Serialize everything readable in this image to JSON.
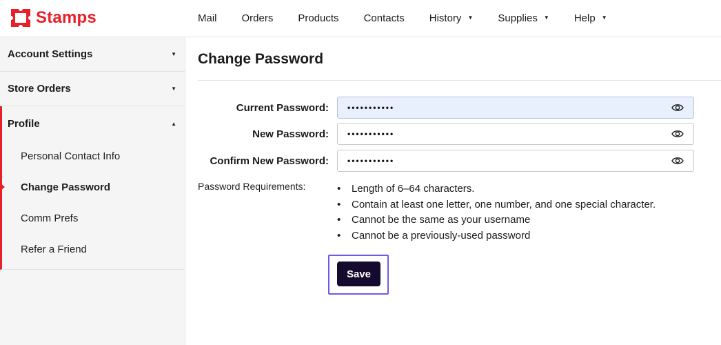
{
  "app": {
    "brand": "Stamps",
    "brand_color": "#e8202a"
  },
  "header": {
    "nav": [
      {
        "label": "Mail",
        "has_dropdown": false
      },
      {
        "label": "Orders",
        "has_dropdown": false
      },
      {
        "label": "Products",
        "has_dropdown": false
      },
      {
        "label": "Contacts",
        "has_dropdown": false
      },
      {
        "label": "History",
        "has_dropdown": true
      },
      {
        "label": "Supplies",
        "has_dropdown": true
      },
      {
        "label": "Help",
        "has_dropdown": true
      }
    ]
  },
  "sidebar": {
    "sections": [
      {
        "label": "Account Settings",
        "expanded": false
      },
      {
        "label": "Store Orders",
        "expanded": false
      },
      {
        "label": "Profile",
        "expanded": true
      }
    ],
    "profile_items": [
      {
        "label": "Personal Contact Info",
        "active": false
      },
      {
        "label": "Change Password",
        "active": true
      },
      {
        "label": "Comm Prefs",
        "active": false
      },
      {
        "label": "Refer a Friend",
        "active": false
      }
    ]
  },
  "main": {
    "title": "Change Password",
    "fields": [
      {
        "label": "Current Password:",
        "value": "•••••••••••",
        "focused": true,
        "icon": "eye-icon"
      },
      {
        "label": "New Password:",
        "value": "•••••••••••",
        "focused": false,
        "icon": "eye-icon"
      },
      {
        "label": "Confirm New Password:",
        "value": "•••••••••••",
        "focused": false,
        "icon": "eye-icon"
      }
    ],
    "requirements_label": "Password Requirements:",
    "requirements": [
      "Length of 6–64 characters.",
      "Contain at least one letter, one number, and one special character.",
      "Cannot be the same as your username",
      "Cannot be a previously-used password"
    ],
    "save_label": "Save",
    "save_color": "#140a2e",
    "focus_ring_color": "#6b5ce7"
  }
}
